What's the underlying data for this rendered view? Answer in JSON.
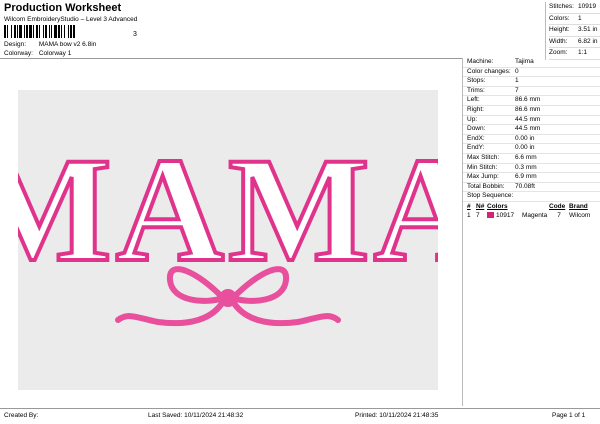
{
  "header": {
    "title": "Production Worksheet",
    "subtitle": "Wilcom EmbroideryStudio – Level 3 Advanced",
    "barcode_mark": "3"
  },
  "info": {
    "design_label": "Design:",
    "design_value": "MAMA bow v2 6.8in",
    "colorway_label": "Colorway:",
    "colorway_value": "Colorway 1"
  },
  "stats": [
    {
      "label": "Stitches:",
      "value": "10919"
    },
    {
      "label": "Colors:",
      "value": "1"
    },
    {
      "label": "Height:",
      "value": "3.51 in"
    },
    {
      "label": "Width:",
      "value": "6.82 in"
    },
    {
      "label": "Zoom:",
      "value": "1:1"
    }
  ],
  "machine": [
    {
      "label": "Machine:",
      "value": "Tajima"
    },
    {
      "label": "Color changes:",
      "value": "0"
    },
    {
      "label": "Stops:",
      "value": "1"
    },
    {
      "label": "Trims:",
      "value": "7"
    },
    {
      "label": "Left:",
      "value": "86.6 mm"
    },
    {
      "label": "Right:",
      "value": "86.6 mm"
    },
    {
      "label": "Up:",
      "value": "44.5 mm"
    },
    {
      "label": "Down:",
      "value": "44.5 mm"
    },
    {
      "label": "EndX:",
      "value": "0.00 in"
    },
    {
      "label": "EndY:",
      "value": "0.00 in"
    },
    {
      "label": "Max Stitch:",
      "value": "6.6 mm"
    },
    {
      "label": "Min Stitch:",
      "value": "0.3 mm"
    },
    {
      "label": "Max Jump:",
      "value": "6.9 mm"
    },
    {
      "label": "Total Bobbin:",
      "value": "70.08ft"
    }
  ],
  "stop_sequence": {
    "label": "Stop Sequence:",
    "headers": [
      "#",
      "N#",
      "Colors",
      "Code",
      "Brand"
    ],
    "rows": [
      {
        "num": "1",
        "n": "7",
        "count": "10917",
        "color": "Magenta",
        "code": "7",
        "brand": "Wilcom",
        "swatch": "#d6237a"
      }
    ]
  },
  "design": {
    "text": "MAMA",
    "fill": "#ffffff",
    "outline": "#e0338c",
    "bow": "#e84f9c"
  },
  "footer": {
    "created": "Created By:",
    "saved": "Last Saved: 10/11/2024 21:48:32",
    "printed": "Printed: 10/11/2024 21:48:35",
    "page": "Page 1 of 1"
  }
}
